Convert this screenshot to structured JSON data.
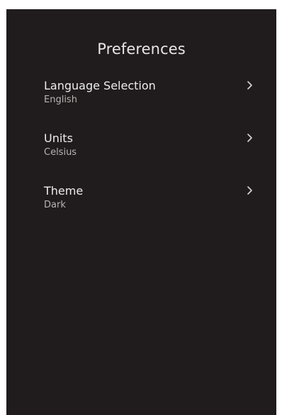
{
  "page": {
    "title": "Preferences"
  },
  "settings": [
    {
      "label": "Language Selection",
      "value": "English",
      "icon": "chevron-right-icon"
    },
    {
      "label": "Units",
      "value": "Celsius",
      "icon": "chevron-right-icon"
    },
    {
      "label": "Theme",
      "value": "Dark",
      "icon": "chevron-right-icon"
    }
  ],
  "colors": {
    "background": "#201c1d",
    "primary_text": "#eeecec",
    "secondary_text": "#b7b3b3"
  }
}
